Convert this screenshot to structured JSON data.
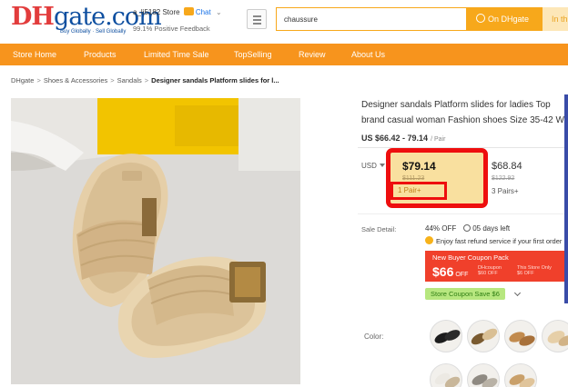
{
  "header": {
    "logo_dh": "DH",
    "logo_gate": "gate.com",
    "logo_tagline": "Buy Globally · Sell Globally",
    "store_name": "a_li5182 Store",
    "chat_label": "Chat",
    "feedback": "99.1% Positive Feedback",
    "search_value": "chaussure",
    "search_button": "On DHgate",
    "search_button_2": "In this store"
  },
  "nav": {
    "items": [
      "Store Home",
      "Products",
      "Limited Time Sale",
      "TopSelling",
      "Review",
      "About Us"
    ]
  },
  "breadcrumb": [
    "DHgate",
    "Shoes & Accessories",
    "Sandals",
    "Designer sandals Platform slides for l..."
  ],
  "product": {
    "title_line1": "Designer sandals Platform slides for ladies Top",
    "title_line2": "brand casual woman Fashion shoes Size 35-42 W",
    "price_range": "US $66.42 - 79.14",
    "price_unit": "/ Pair",
    "currency": "USD",
    "tiers": [
      {
        "price": "$79.14",
        "old_price": "$111.23",
        "qty": "1 Pair+"
      },
      {
        "price": "$68.84",
        "old_price": "$122.92",
        "qty": "3 Pairs+"
      }
    ]
  },
  "sale": {
    "label": "Sale Detail:",
    "discount": "44% OFF",
    "days_left": "05 days left",
    "refund": "Enjoy fast refund service if your first order",
    "coupon_title": "New Buyer Coupon Pack",
    "coupon_amount": "$66",
    "coupon_off": "OFF",
    "coupon_sub1_a": "DHcoupon",
    "coupon_sub1_b": "$60 OFF",
    "coupon_sub2_a": "This Store Only",
    "coupon_sub2_b": "$6 OFF",
    "store_coupon": "Store Coupon Save $6"
  },
  "color": {
    "label": "Color:"
  },
  "colors": {
    "nav_bg": "#f7941d",
    "accent": "#f7a81b",
    "highlight_border": "#ee0e0e",
    "tier_bg": "#f9e09f"
  }
}
